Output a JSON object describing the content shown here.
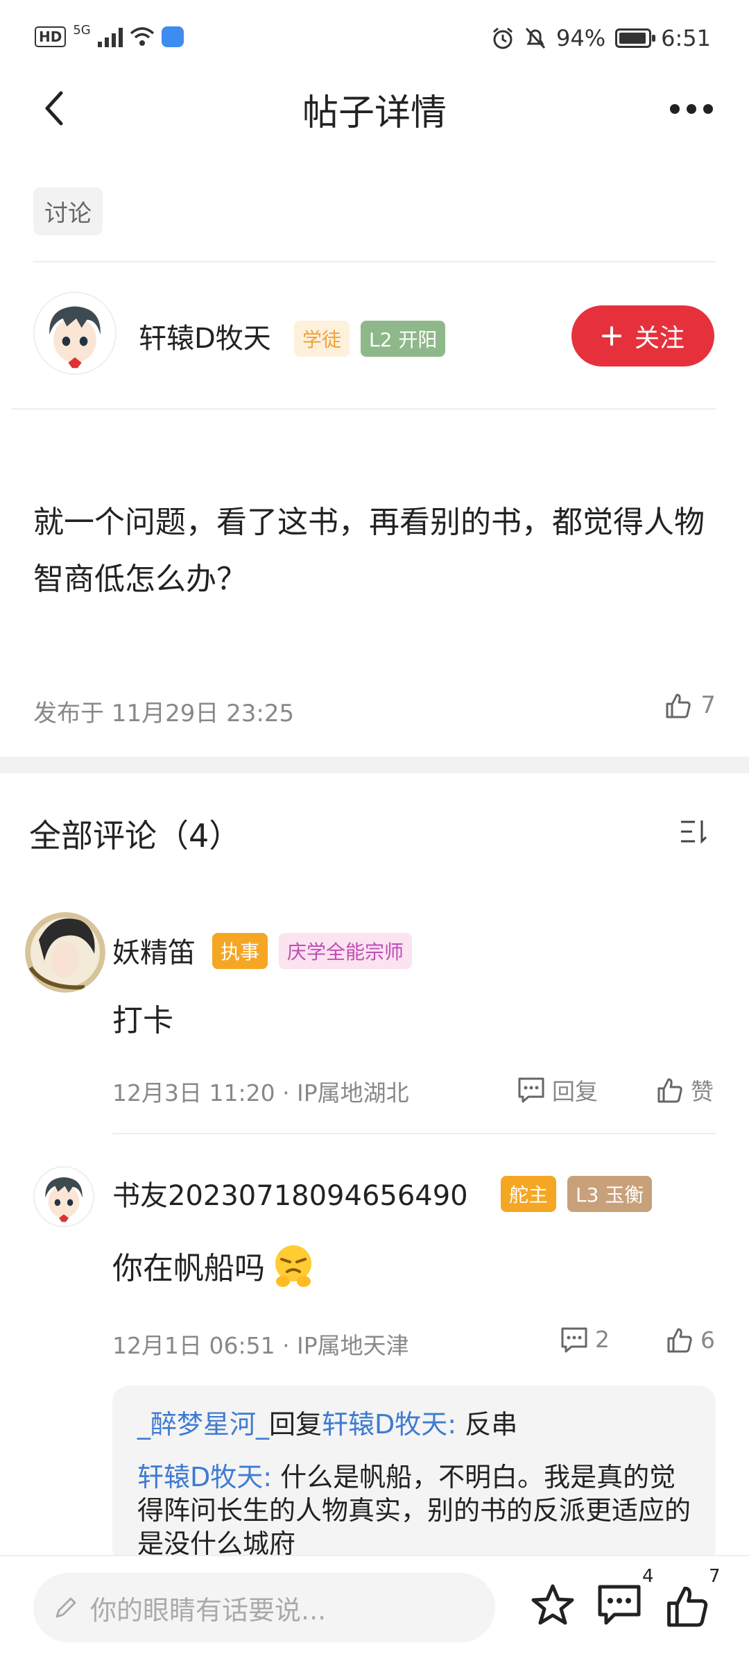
{
  "status_bar": {
    "network": "5G",
    "battery": "94%",
    "battery_level": 0.94,
    "time": "6:51"
  },
  "header": {
    "title": "帖子详情"
  },
  "post": {
    "tag": "讨论",
    "author": {
      "name": "轩辕D牧天",
      "badge_rank": "学徒",
      "badge_level": "L2 开阳"
    },
    "follow_label": "关注",
    "content": "就一个问题，看了这书，再看别的书，都觉得人物智商低怎么办？",
    "published": "发布于 11月29日 23:25",
    "likes": "7"
  },
  "comments_header": {
    "title": "全部评论（4）"
  },
  "comments": [
    {
      "name": "妖精笛",
      "badge1": "执事",
      "badge2": "庆学全能宗师",
      "text": "打卡",
      "meta": "12月3日 11:20 · IP属地湖北",
      "reply_label": "回复",
      "like_label": "赞"
    },
    {
      "name": "书友20230718094656490",
      "badge1": "舵主",
      "badge2": "L3 玉衡",
      "text": "你在帆船吗",
      "meta": "12月1日 06:51 · IP属地天津",
      "reply_count": "2",
      "like_count": "6"
    }
  ],
  "replies": [
    {
      "from": "_醉梦星河_",
      "verb": "回复",
      "to": "轩辕D牧天:",
      "text": " 反串"
    },
    {
      "from": "轩辕D牧天:",
      "text": " 什么是帆船，不明白。我是真的觉得阵问长生的人物真实，别的书的反派"
    }
  ],
  "reply_line3": "更适应的是没什么城府",
  "bottom_bar": {
    "placeholder": "你的眼睛有话要说...",
    "comment_count": "4",
    "like_count": "7"
  },
  "colors": {
    "accent": "#e6313d",
    "link": "#3f7bd1",
    "badge_orange_bg": "#fdf1dc",
    "badge_green_bg": "#8fb88a"
  }
}
